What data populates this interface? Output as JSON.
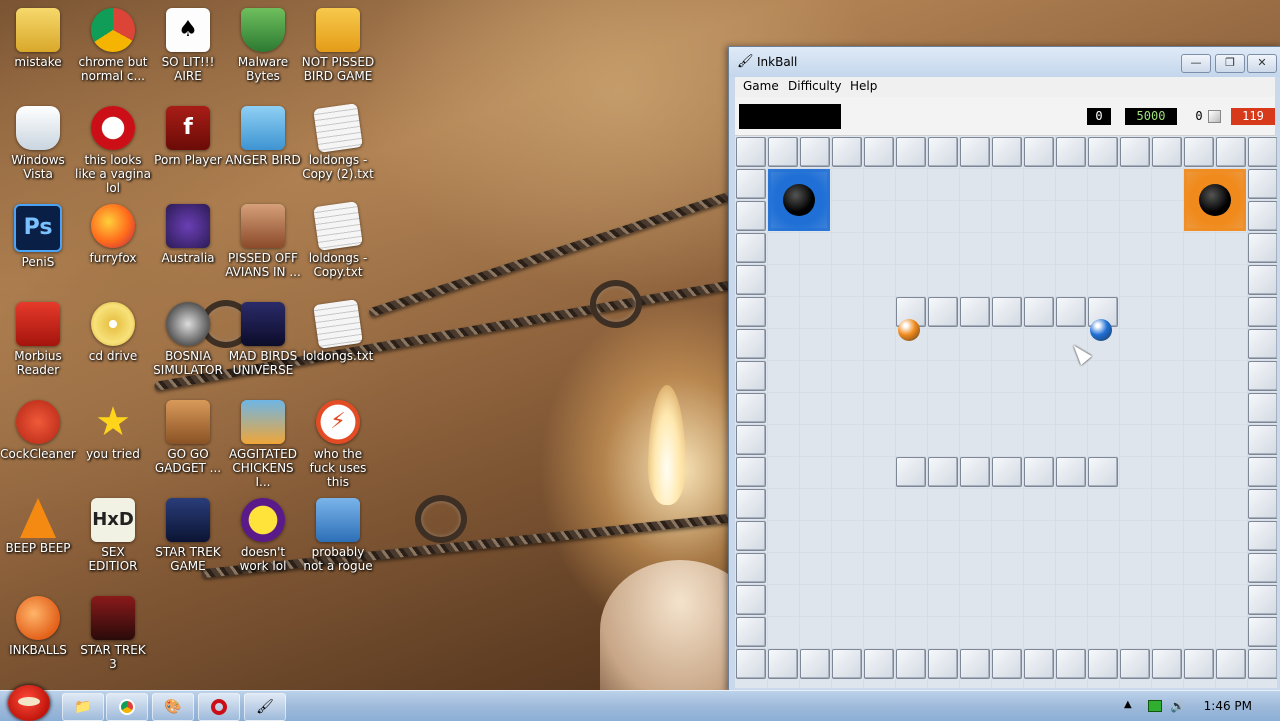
{
  "desktop": {
    "icons": [
      {
        "label": "mistake",
        "icon": "folder-mistake-icon"
      },
      {
        "label": "chrome but normal c...",
        "icon": "chrome-icon"
      },
      {
        "label": "SO LIT!!! AIRE",
        "icon": "cards-icon"
      },
      {
        "label": "Malware Bytes",
        "icon": "shield-check-icon"
      },
      {
        "label": "NOT PISSED BIRD GAME",
        "icon": "green-pig-icon"
      },
      {
        "label": "Windows Vista",
        "icon": "recycle-bin-icon"
      },
      {
        "label": "this looks like a vagina lol",
        "icon": "opera-icon"
      },
      {
        "label": "Porn Player",
        "icon": "flash-icon"
      },
      {
        "label": "ANGER BIRD",
        "icon": "angry-bird-icon"
      },
      {
        "label": "loldongs - Copy (2).txt",
        "icon": "text-file-icon"
      },
      {
        "label": "PeniS",
        "icon": "photoshop-icon"
      },
      {
        "label": "furryfox",
        "icon": "firefox-icon"
      },
      {
        "label": "Australia",
        "icon": "spider-icon"
      },
      {
        "label": "PISSED OFF AVIANS IN ...",
        "icon": "angry-birds-seasons-icon"
      },
      {
        "label": "loldongs - Copy.txt",
        "icon": "text-file-icon"
      },
      {
        "label": "Morbius Reader",
        "icon": "pdf-reader-icon"
      },
      {
        "label": "cd drive",
        "icon": "cd-icon"
      },
      {
        "label": "BOSNIA SIMULATOR",
        "icon": "mine-icon"
      },
      {
        "label": "MAD BIRDS UNIVERSE",
        "icon": "angry-birds-space-icon"
      },
      {
        "label": "loldongs.txt",
        "icon": "text-file-icon"
      },
      {
        "label": "CockCleaner",
        "icon": "ccleaner-icon"
      },
      {
        "label": "you tried",
        "icon": "star-icon"
      },
      {
        "label": "GO GO GADGET ...",
        "icon": "briefcase-icon"
      },
      {
        "label": "AGGITATED CHICKENS I...",
        "icon": "angry-birds-rio-icon"
      },
      {
        "label": "who the fuck uses this",
        "icon": "lightning-icon"
      },
      {
        "label": "BEEP BEEP",
        "icon": "vlc-cone-icon"
      },
      {
        "label": "SEX EDITIOR",
        "icon": "hxd-icon"
      },
      {
        "label": "STAR TREK GAME",
        "icon": "star-wars-birds-icon"
      },
      {
        "label": "doesn't work lol",
        "icon": "yahoo-messenger-icon"
      },
      {
        "label": "probably not a rogue",
        "icon": "gear-monitor-icon"
      },
      {
        "label": "INKBALLS",
        "icon": "inkball-icon"
      },
      {
        "label": "STAR TREK 3",
        "icon": "star-wars-2-icon"
      }
    ]
  },
  "window": {
    "title": "InkBall",
    "controls": {
      "minimize": "—",
      "maximize": "❐",
      "close": "✕"
    },
    "menu": [
      "Game",
      "Difficulty",
      "Help"
    ],
    "scores": {
      "left_counter": "0",
      "score": "5000",
      "balls_counter": "0",
      "timer": "119"
    },
    "colors": {
      "blue": "#1f6fd6",
      "orange": "#f08a1c",
      "timer_red": "#d73a1a",
      "score_green": "#9be07a"
    }
  },
  "taskbar": {
    "clock": "1:46 PM",
    "items": [
      "angry-bird-start-icon",
      "folder-icon",
      "chrome-icon",
      "paint-icon",
      "opera-icon",
      "inkball-icon"
    ]
  }
}
